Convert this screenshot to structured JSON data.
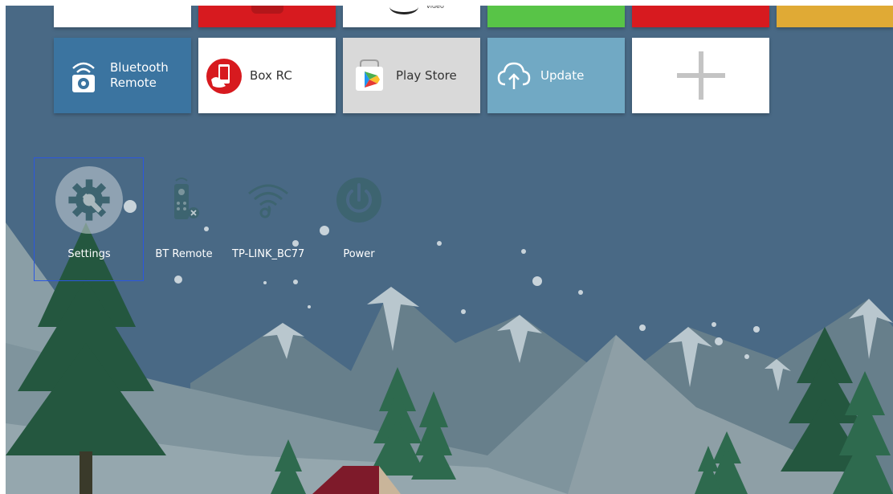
{
  "colors": {
    "background": "#496985",
    "mountain": "#728a94",
    "tree_dark": "#24573f",
    "tree_light": "#2e6a4e",
    "focus_border": "#2b57e0"
  },
  "top_row": [
    {
      "name": "top-tile-1",
      "color": "#ffffff"
    },
    {
      "name": "top-tile-youtube",
      "color": "#d71a1f"
    },
    {
      "name": "top-tile-video",
      "color": "#ffffff",
      "label": "video"
    },
    {
      "name": "top-tile-green",
      "color": "#58c447"
    },
    {
      "name": "top-tile-red",
      "color": "#d71a1f"
    },
    {
      "name": "top-tile-orange",
      "color": "#e0aa35"
    }
  ],
  "apps": [
    {
      "label_line1": "Bluetooth",
      "label_line2": "Remote",
      "icon": "bluetooth-remote-icon",
      "bg": "#3b74a0",
      "text_color": "#ffffff"
    },
    {
      "label": "Box RC",
      "icon": "box-rc-icon",
      "bg": "#ffffff",
      "text_color": "#333333"
    },
    {
      "label": "Play Store",
      "icon": "play-store-icon",
      "bg": "#d9d9d9",
      "text_color": "#333333"
    },
    {
      "label": "Update",
      "icon": "cloud-upload-icon",
      "bg": "#71a9c4",
      "text_color": "#ffffff"
    },
    {
      "label": "",
      "icon": "add-icon",
      "bg": "#ffffff"
    }
  ],
  "quick_settings": [
    {
      "label": "Settings",
      "icon": "gear-wrench-icon",
      "selected": true
    },
    {
      "label": "BT Remote",
      "icon": "remote-disconnected-icon"
    },
    {
      "label": "TP-LINK_BC77",
      "icon": "wifi-icon"
    },
    {
      "label": "Power",
      "icon": "power-icon"
    }
  ]
}
